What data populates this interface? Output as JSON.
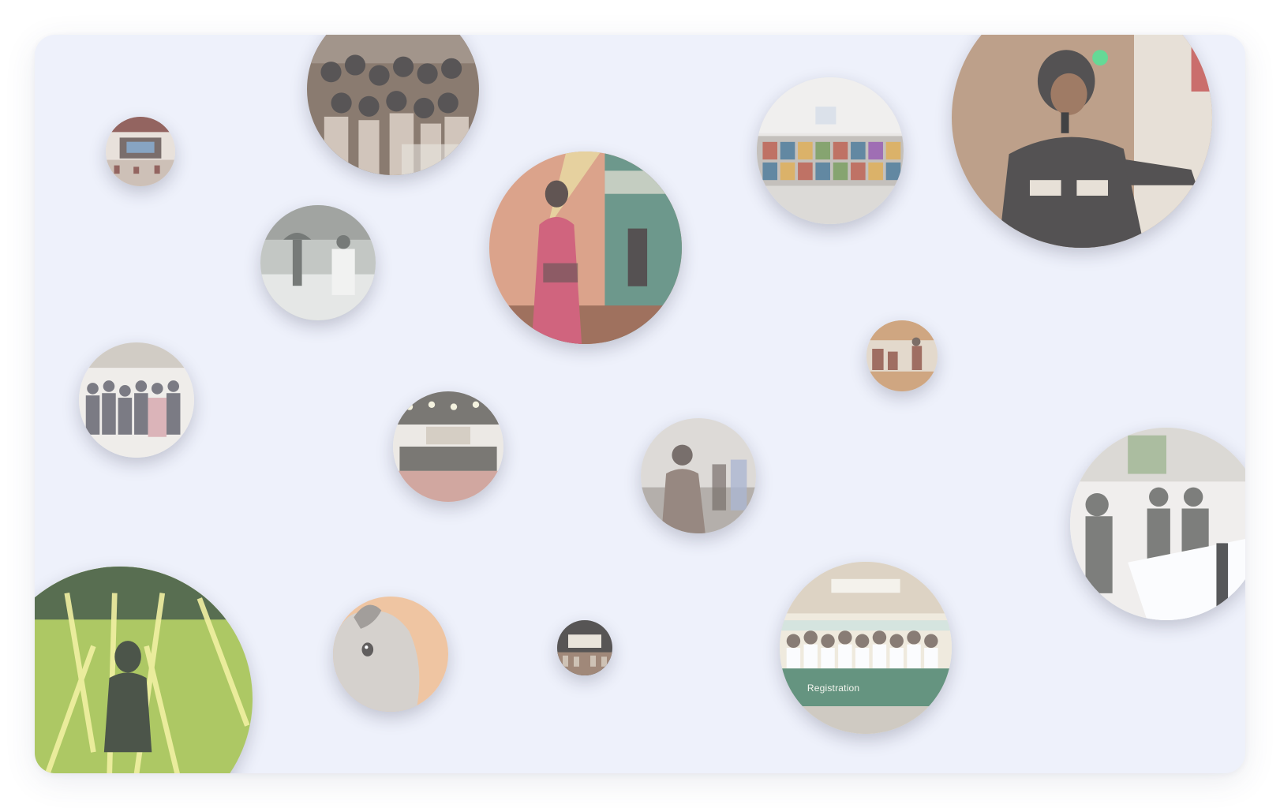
{
  "gallery": {
    "background_color": "#eef1fb",
    "bubbles": [
      {
        "id": "crowd-group-selfie",
        "icon": "group-photo",
        "palette": [
          "#6f5a4a",
          "#2f2a28",
          "#8e7b6c",
          "#c9b9a9"
        ]
      },
      {
        "id": "auditorium-stage-small",
        "icon": "stage-photo",
        "palette": [
          "#7a3d35",
          "#c5b3a4",
          "#e7ddd2",
          "#5a4a45"
        ]
      },
      {
        "id": "hallway-paintings",
        "icon": "exhibition-photo",
        "palette": [
          "#b9b3ab",
          "#e9e6e1",
          "#b34f3c",
          "#3c6b8a"
        ]
      },
      {
        "id": "singer-performer",
        "icon": "performer-photo",
        "palette": [
          "#b08a6b",
          "#2a2624",
          "#e6dccd",
          "#c14a45"
        ]
      },
      {
        "id": "dancer-pink-saree",
        "icon": "dancer-photo",
        "palette": [
          "#d68e6c",
          "#c83d5c",
          "#4a7f6d",
          "#e8d78d"
        ]
      },
      {
        "id": "campus-walk-umbrella",
        "icon": "outdoor-photo",
        "palette": [
          "#8c8f88",
          "#b8bbb5",
          "#555954",
          "#e3e4e0"
        ]
      },
      {
        "id": "classroom-audience",
        "icon": "audience-photo",
        "palette": [
          "#c7915f",
          "#8a4a38",
          "#e1d2bf",
          "#5d4a3e"
        ]
      },
      {
        "id": "students-dance-floor",
        "icon": "group-photo",
        "palette": [
          "#c9c2b7",
          "#5b5a63",
          "#d7a3a7",
          "#f0ece6"
        ]
      },
      {
        "id": "concert-stage-wide",
        "icon": "stage-photo",
        "palette": [
          "#cfc4b5",
          "#5a564f",
          "#ece7df",
          "#b35b4c"
        ]
      },
      {
        "id": "woman-in-crowd",
        "icon": "portrait-photo",
        "palette": [
          "#a59d95",
          "#584b44",
          "#d9d4ce",
          "#7f6b5f"
        ]
      },
      {
        "id": "registration-desk",
        "icon": "registration-photo",
        "palette": [
          "#d7d3cb",
          "#5e5e59",
          "#f1eeea",
          "#8d8a82"
        ]
      },
      {
        "id": "green-light-concert",
        "icon": "concert-photo",
        "palette": [
          "#9bbd3a",
          "#2f4a22",
          "#f3f08a",
          "#1f2a19"
        ]
      },
      {
        "id": "white-rabbit",
        "icon": "rabbit-photo",
        "palette": [
          "#cfc8c0",
          "#f0b98a",
          "#8e8780",
          "#3a3532"
        ]
      },
      {
        "id": "auditorium-stage-tiny",
        "icon": "stage-photo",
        "palette": [
          "#2e2a27",
          "#c6b5a2",
          "#8b6b55",
          "#e8e0d3"
        ]
      },
      {
        "id": "group-registration-banner",
        "icon": "group-photo",
        "palette": [
          "#d9cbb5",
          "#3f7a5e",
          "#f0e8d6",
          "#6c5b50"
        ],
        "caption": "Registration"
      }
    ]
  }
}
